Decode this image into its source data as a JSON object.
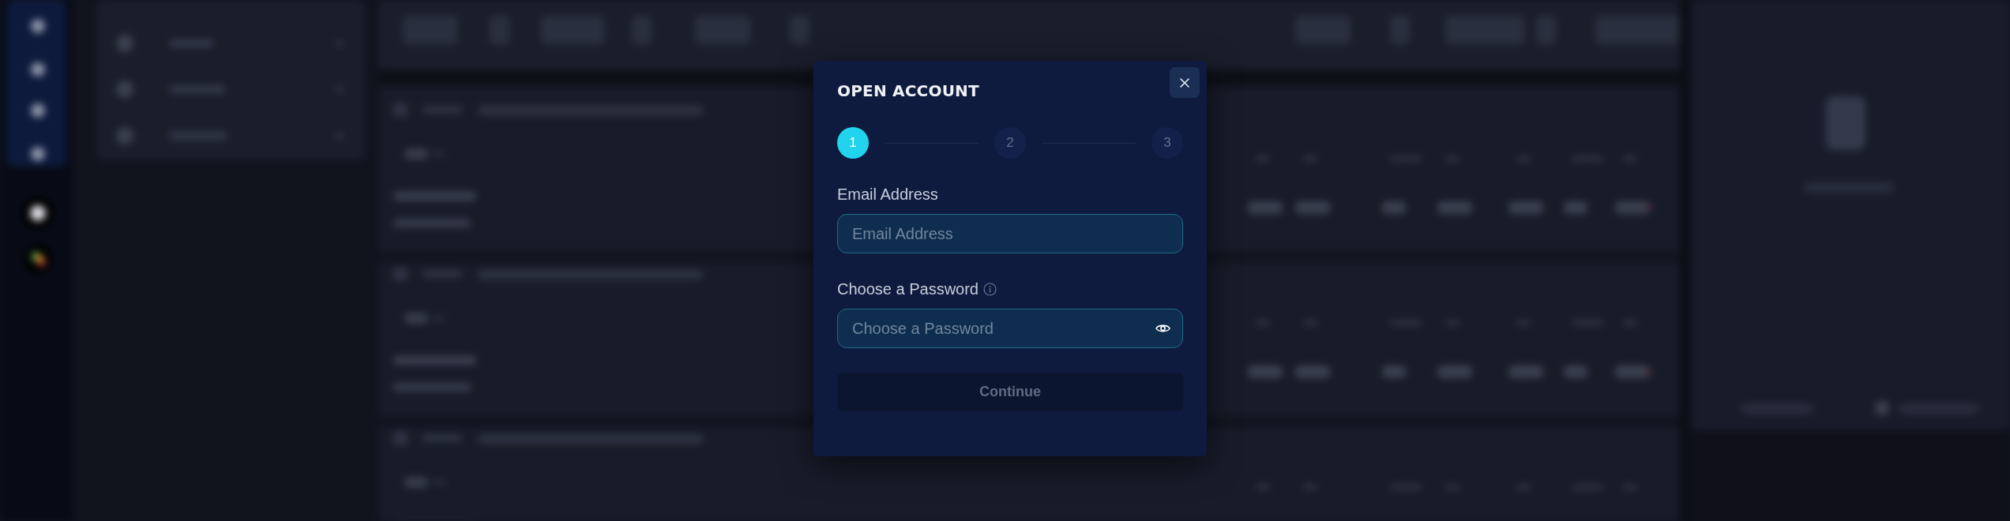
{
  "dialog": {
    "title": "OPEN ACCOUNT",
    "steps": [
      {
        "label": "1",
        "selected": true
      },
      {
        "label": "2",
        "selected": false
      },
      {
        "label": "3",
        "selected": false
      }
    ],
    "fields": [
      {
        "kind": "email",
        "label": "Email Address",
        "placeholder": "Email Address",
        "info": false
      },
      {
        "kind": "password",
        "label": "Choose a Password",
        "placeholder": "Choose a Password",
        "info": true
      }
    ],
    "submit": {
      "label": "Continue",
      "disabled": true
    }
  }
}
